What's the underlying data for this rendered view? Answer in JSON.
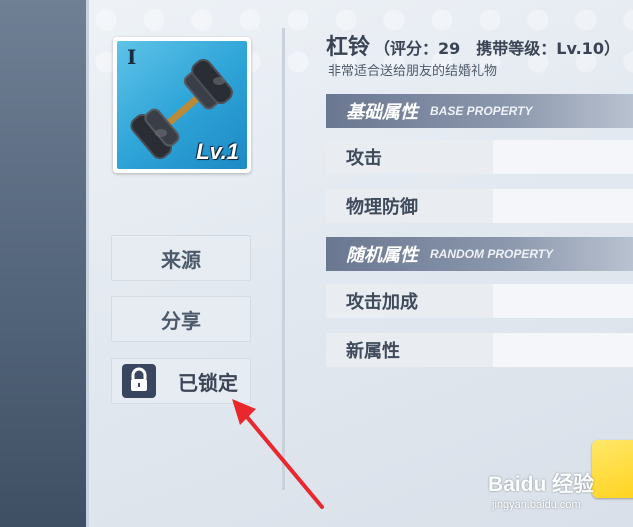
{
  "item": {
    "name": "杠铃",
    "meta": "（评分：29　携带等级：Lv.10）",
    "description": "非常适合送给朋友的结婚礼物",
    "rarity": "I",
    "level_badge": "Lv.1",
    "icon": "barbell-icon"
  },
  "side_buttons": {
    "source_label": "来源",
    "share_label": "分享",
    "locked_label": "已锁定"
  },
  "sections": {
    "base": {
      "title": "基础属性",
      "subtitle_en": "BASE PROPERTY",
      "stats": [
        "攻击",
        "物理防御"
      ]
    },
    "random": {
      "title": "随机属性",
      "subtitle_en": "RANDOM PROPERTY",
      "stats": [
        "攻击加成",
        "新属性"
      ]
    }
  },
  "watermark": {
    "logo": "Baidu 经验",
    "url": "jingyan.baidu.com"
  },
  "colors": {
    "accent_yellow": "#ffd21a",
    "arrow_red": "#e8282d",
    "item_bg": "#2fa5d8"
  }
}
